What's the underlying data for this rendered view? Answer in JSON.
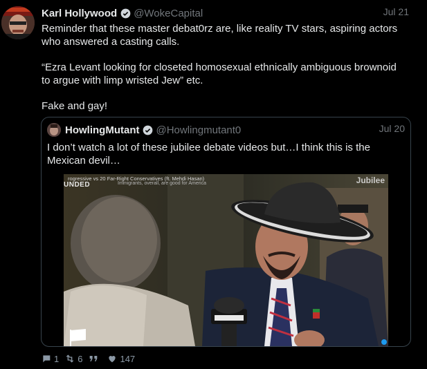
{
  "tweet": {
    "author_name": "Karl Hollywood",
    "author_handle": "@WokeCapital",
    "date": "Jul 21",
    "paragraphs": [
      "Reminder that these master debat0rz are, like reality TV stars, aspiring actors who answered a casting calls.",
      "“Ezra Levant looking for closeted homosexual ethnically ambiguous brownoid to argue with limp wristed Jew” etc.",
      "Fake and gay!"
    ]
  },
  "quote": {
    "author_name": "HowlingMutant",
    "author_handle": "@Howlingmutant0",
    "date": "Jul 20",
    "text": "I don’t watch a lot of these jubilee debate videos but…I think this is the Mexican devil…",
    "media": {
      "title": "rogressive vs 20 Far-Right Conservatives (ft. Mehdi Hasan)",
      "subtitle": "Immigrants, overall, are good for America",
      "left_label": "UNDED",
      "brand": "Jubilee"
    }
  },
  "actions": {
    "replies": "1",
    "retweets": "6",
    "likes": "147"
  },
  "colors": {
    "background": "#000000",
    "text": "#e7e9ea",
    "muted": "#71767b",
    "verified": "#1d9bf0",
    "border": "#38444d"
  }
}
